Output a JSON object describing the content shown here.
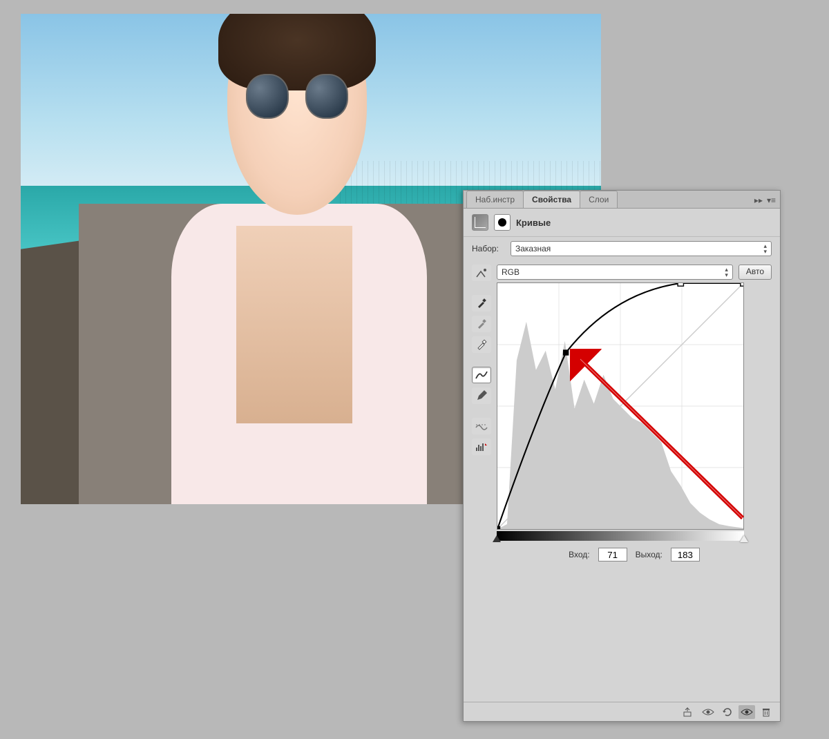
{
  "tabs": {
    "presets": "Наб.инстр",
    "properties": "Свойства",
    "layers": "Слои"
  },
  "header": {
    "title": "Кривые"
  },
  "preset": {
    "label": "Набор:",
    "value": "Заказная"
  },
  "channel": {
    "value": "RGB",
    "auto": "Авто"
  },
  "io": {
    "input_label": "Вход:",
    "input_value": "71",
    "output_label": "Выход:",
    "output_value": "183"
  },
  "icons": {
    "hand": "hand-icon",
    "dropper1": "eyedropper-black-icon",
    "dropper2": "eyedropper-gray-icon",
    "dropper3": "eyedropper-white-icon",
    "curve": "curve-icon",
    "pencil": "pencil-icon",
    "smooth": "smooth-icon",
    "hist": "histogram-icon"
  },
  "chart_data": {
    "type": "line",
    "title": "Curves adjustment",
    "xlabel": "Input",
    "ylabel": "Output",
    "xlim": [
      0,
      255
    ],
    "ylim": [
      0,
      255
    ],
    "control_points": [
      {
        "in": 0,
        "out": 0
      },
      {
        "in": 71,
        "out": 183
      },
      {
        "in": 190,
        "out": 255
      },
      {
        "in": 255,
        "out": 255
      }
    ],
    "histogram_peaks": [
      {
        "x": 25,
        "h": 0.95
      },
      {
        "x": 45,
        "h": 0.75
      },
      {
        "x": 70,
        "h": 0.85
      },
      {
        "x": 95,
        "h": 0.65
      },
      {
        "x": 120,
        "h": 0.68
      },
      {
        "x": 145,
        "h": 0.55
      },
      {
        "x": 170,
        "h": 0.45
      },
      {
        "x": 195,
        "h": 0.22
      },
      {
        "x": 215,
        "h": 0.1
      },
      {
        "x": 235,
        "h": 0.04
      }
    ]
  }
}
